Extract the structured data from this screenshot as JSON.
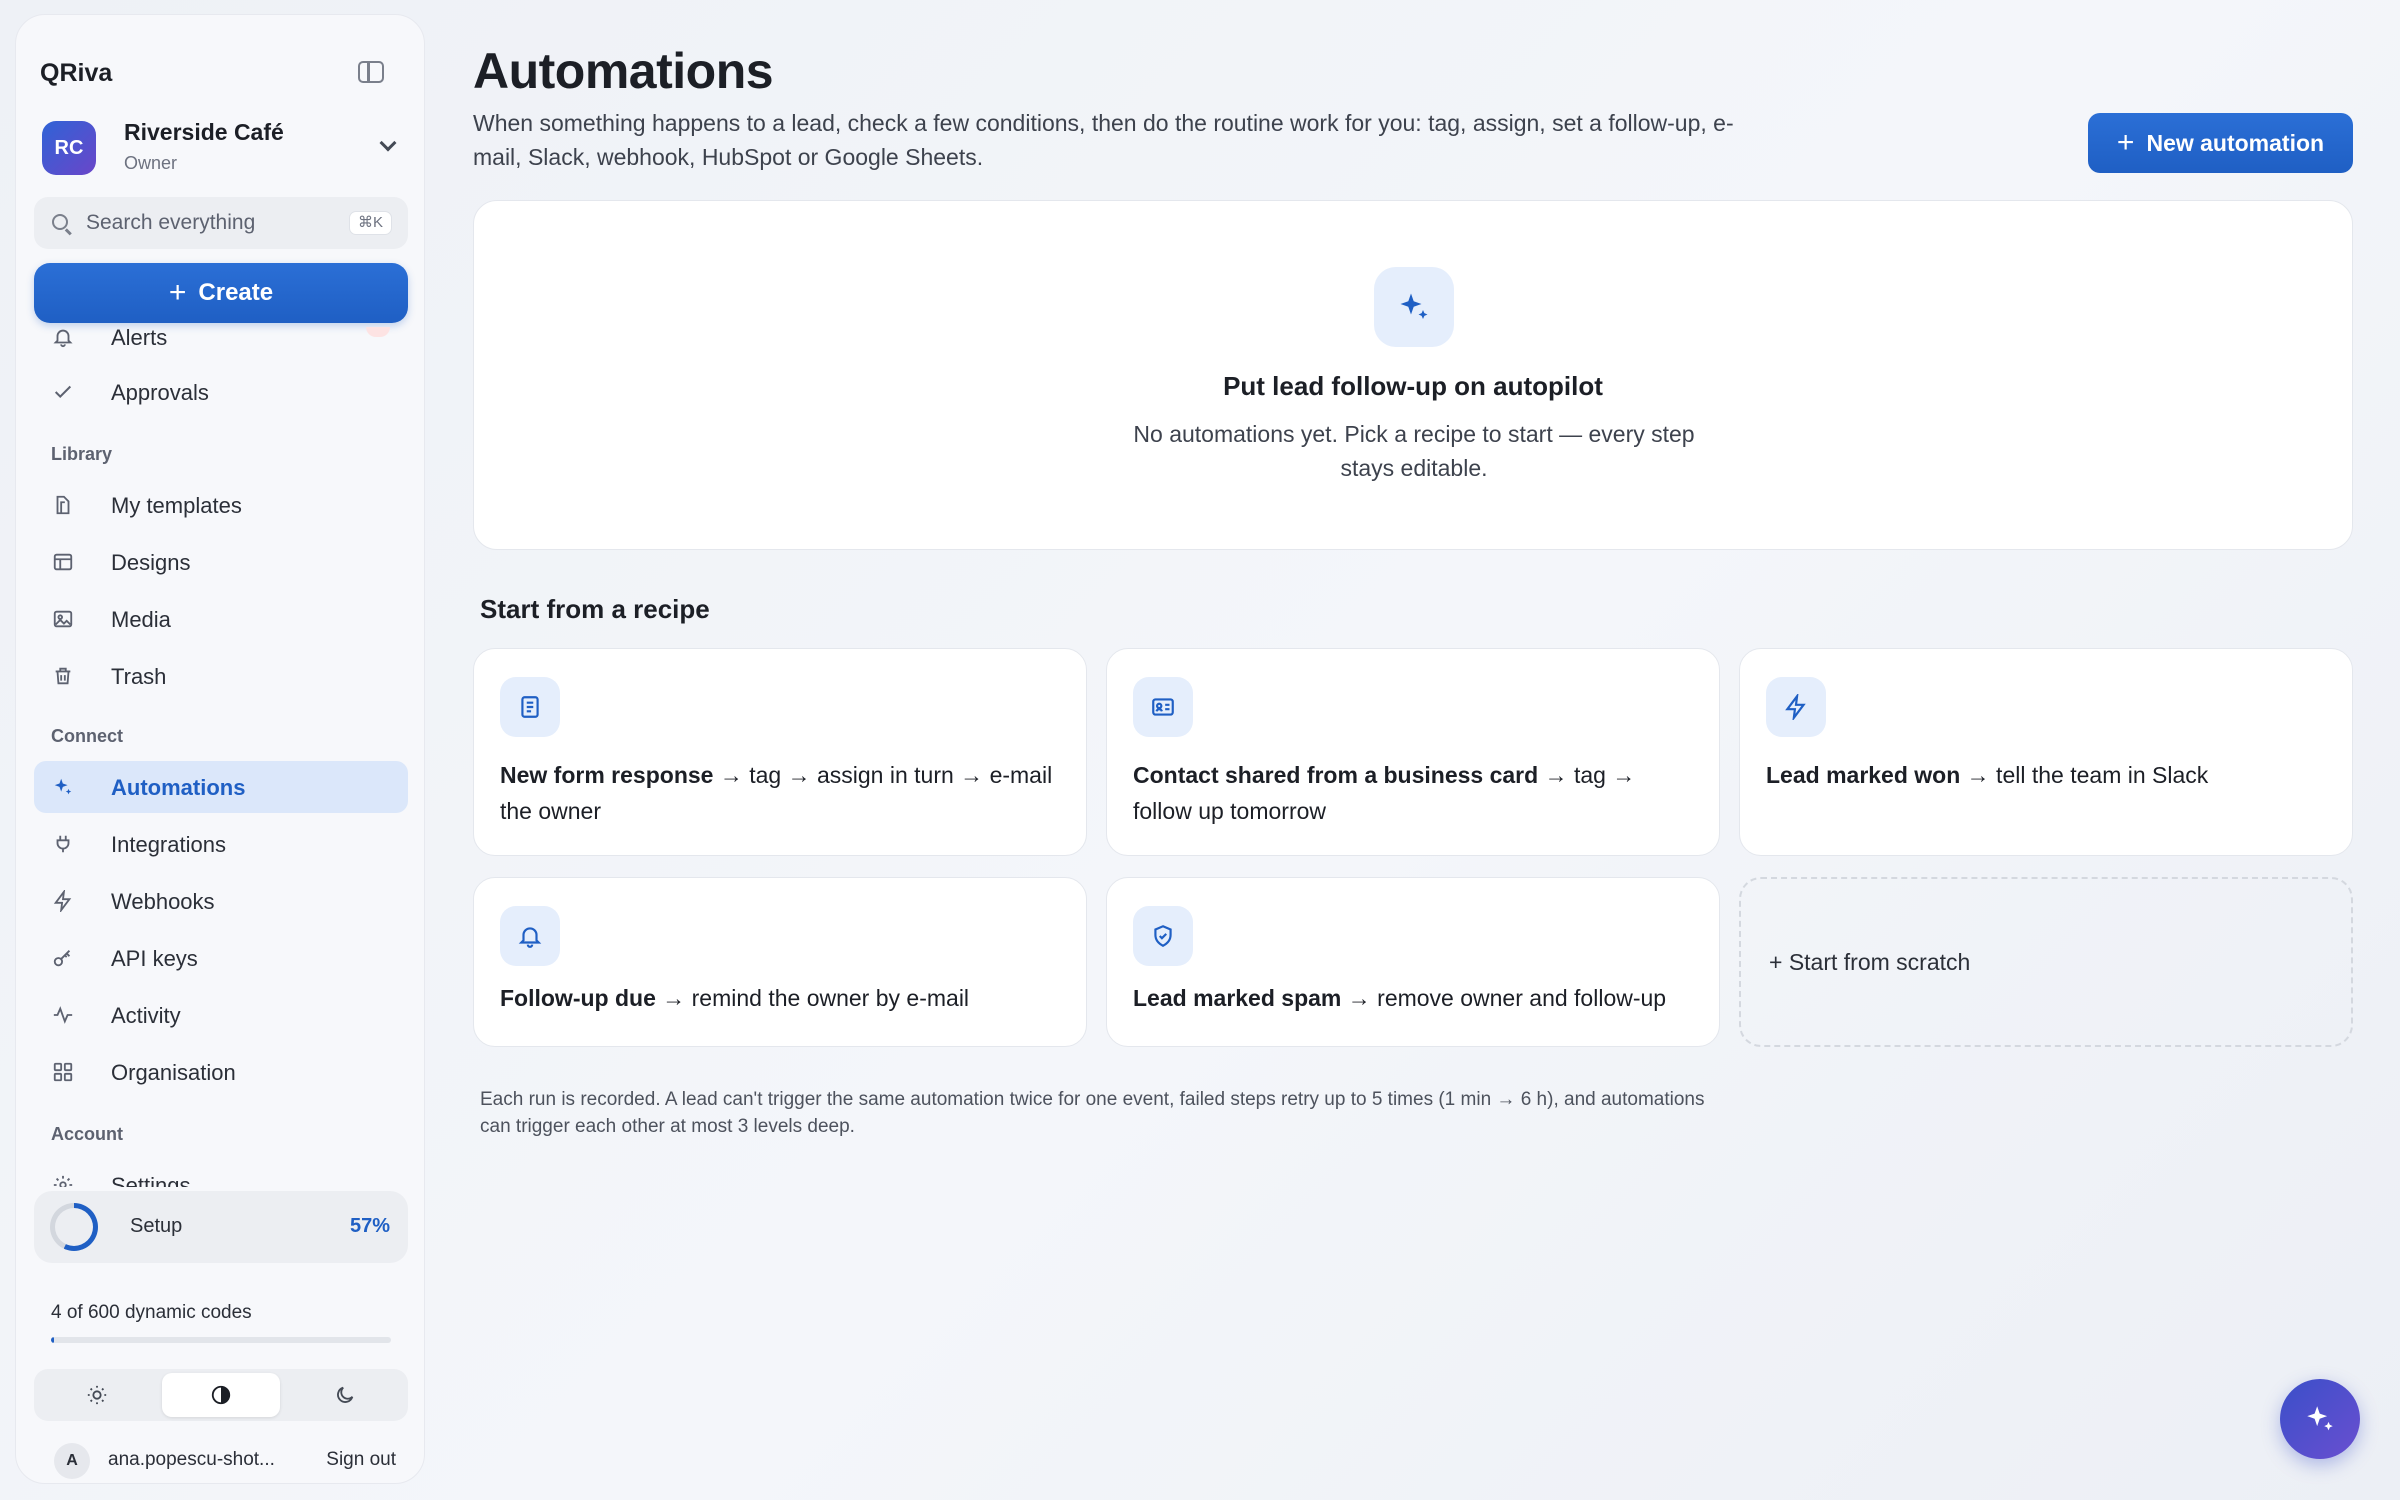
{
  "sidebar": {
    "brand": "QRiva",
    "org": {
      "initials": "RC",
      "name": "Riverside Café",
      "role": "Owner"
    },
    "search": {
      "placeholder": "Search everything",
      "shortcut": "⌘K"
    },
    "create_label": "Create",
    "top_items": [
      {
        "label": "Alerts",
        "icon": "bell-icon"
      },
      {
        "label": "Approvals",
        "icon": "check-icon"
      }
    ],
    "library": {
      "label": "Library",
      "items": [
        {
          "label": "My templates",
          "icon": "template-icon"
        },
        {
          "label": "Designs",
          "icon": "layout-icon"
        },
        {
          "label": "Media",
          "icon": "image-icon"
        },
        {
          "label": "Trash",
          "icon": "trash-icon"
        }
      ]
    },
    "connect": {
      "label": "Connect",
      "items": [
        {
          "label": "Automations",
          "icon": "sparkle-icon",
          "active": true
        },
        {
          "label": "Integrations",
          "icon": "plug-icon"
        },
        {
          "label": "Webhooks",
          "icon": "bolt-icon"
        },
        {
          "label": "API keys",
          "icon": "key-icon"
        },
        {
          "label": "Activity",
          "icon": "activity-icon"
        },
        {
          "label": "Organisation",
          "icon": "grid-icon"
        }
      ]
    },
    "account": {
      "label": "Account",
      "items": [
        {
          "label": "Settings",
          "icon": "gear-icon"
        }
      ]
    },
    "setup": {
      "label": "Setup",
      "percent_label": "57%",
      "percent": 0.57
    },
    "codes": {
      "label": "4 of 600 dynamic codes",
      "used": 4,
      "total": 600
    },
    "theme": {
      "options": [
        "light",
        "system",
        "dark"
      ],
      "selected": "system"
    },
    "user": {
      "initial": "A",
      "email": "ana.popescu-shot...",
      "signout": "Sign out"
    }
  },
  "main": {
    "title": "Automations",
    "description": "When something happens to a lead, check a few conditions, then do the routine work for you: tag, assign, set a follow-up, e-mail, Slack, webhook, HubSpot or Google Sheets.",
    "new_button": "New automation",
    "empty": {
      "title": "Put lead follow-up on autopilot",
      "text": "No automations yet. Pick a recipe to start — every step stays editable."
    },
    "recipes_title": "Start from a recipe",
    "recipes": [
      {
        "icon": "form-icon",
        "trigger": "New form response",
        "rest": " → tag → assign in turn → e-mail the owner"
      },
      {
        "icon": "contact-card-icon",
        "trigger": "Contact shared from a business card",
        "rest": " → tag → follow up tomorrow"
      },
      {
        "icon": "bolt-icon",
        "trigger": "Lead marked won",
        "rest": " → tell the team in Slack"
      },
      {
        "icon": "bell-icon",
        "trigger": "Follow-up due",
        "rest": " → remind the owner by e-mail"
      },
      {
        "icon": "shield-check-icon",
        "trigger": "Lead marked spam",
        "rest": " → remove owner and follow-up"
      }
    ],
    "scratch_label": "+ Start from scratch",
    "footnote": "Each run is recorded. A lead can't trigger the same automation twice for one event, failed steps retry up to 5 times (1 min → 6 h), and automations can trigger each other at most 3 levels deep."
  },
  "colors": {
    "accent": "#1f5fc4",
    "active_bg": "#dbe7fa",
    "icon_bg": "#e5eefc"
  }
}
